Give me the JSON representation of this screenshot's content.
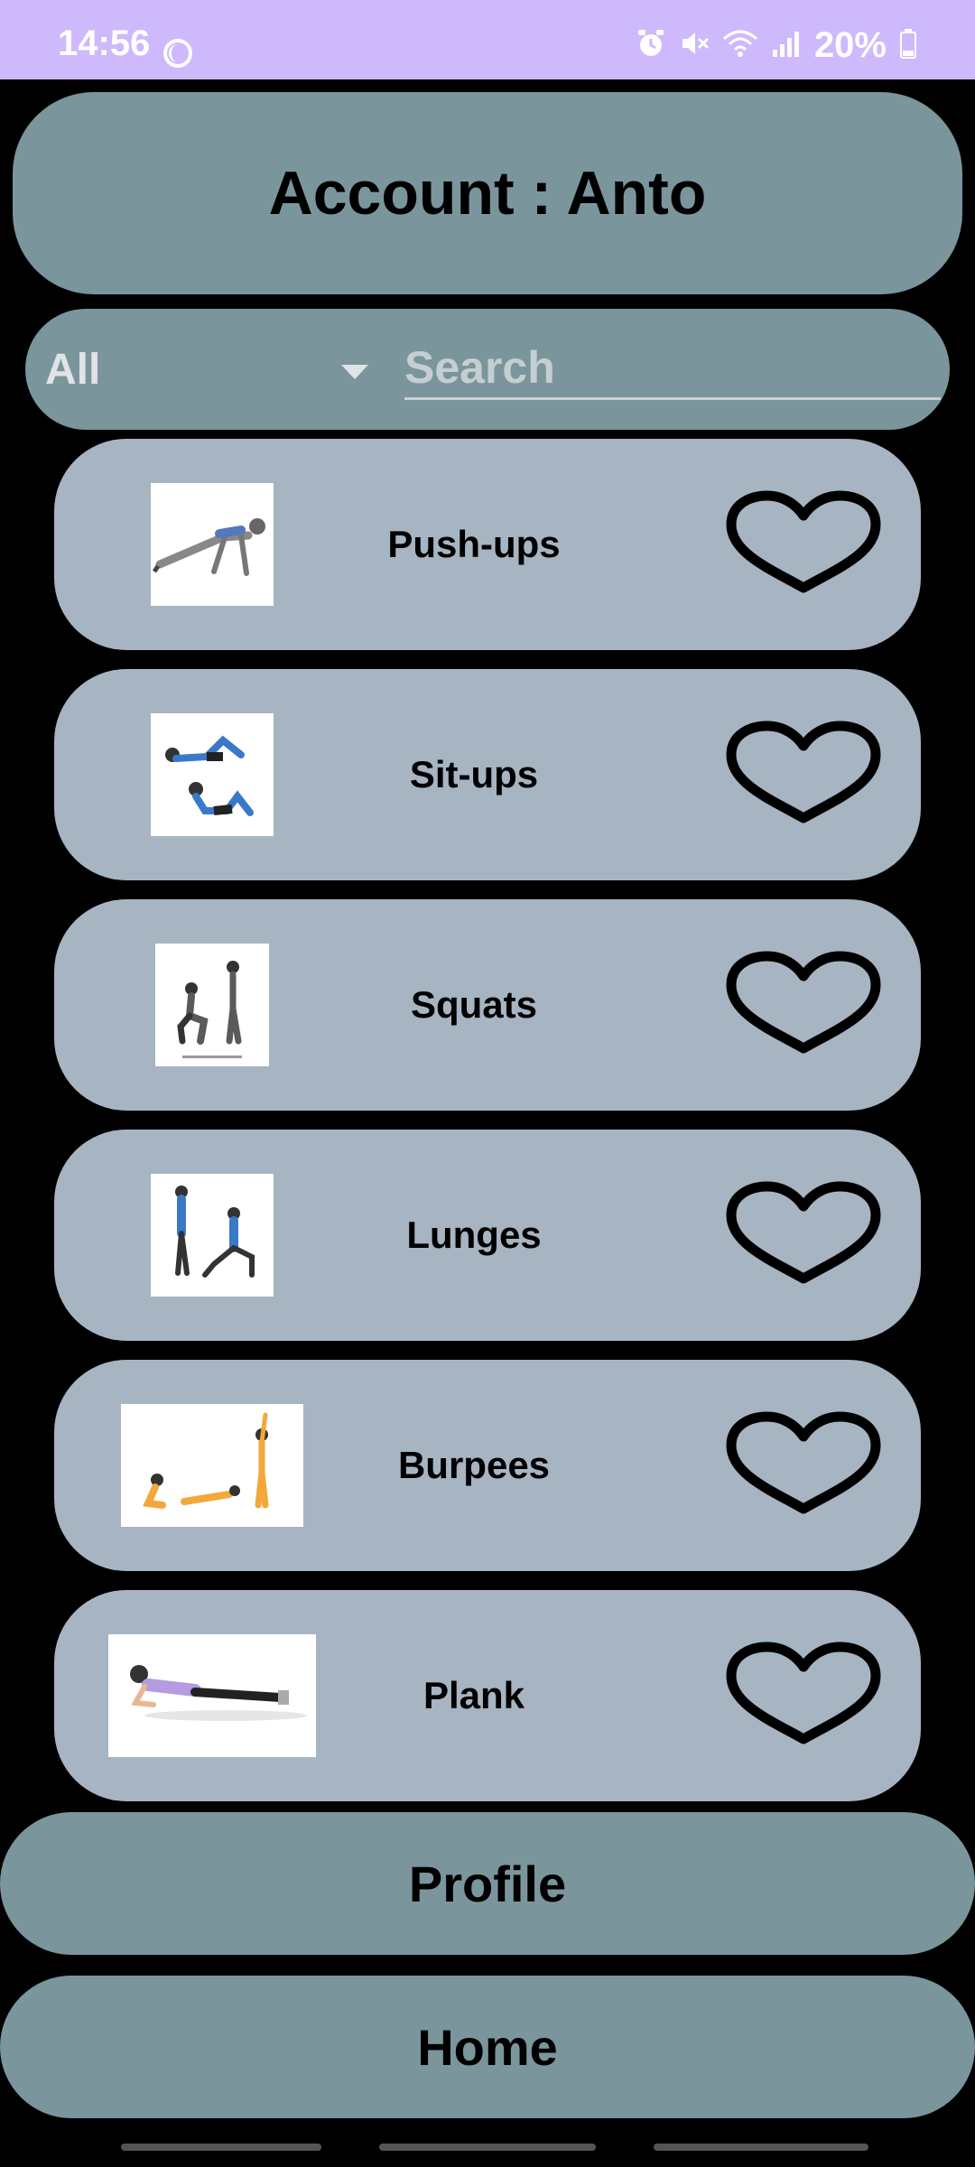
{
  "status_bar": {
    "time": "14:56",
    "battery": "20%",
    "icons": [
      "moon-icon",
      "alarm-icon",
      "mute-icon",
      "wifi-icon",
      "signal-icon",
      "battery-icon"
    ]
  },
  "header": {
    "title": "Account : Anto"
  },
  "filter": {
    "selected": "All",
    "search_placeholder": "Search"
  },
  "exercises": [
    {
      "name": "Push-ups",
      "favorite": false
    },
    {
      "name": "Sit-ups",
      "favorite": false
    },
    {
      "name": "Squats",
      "favorite": false
    },
    {
      "name": "Lunges",
      "favorite": false
    },
    {
      "name": "Burpees",
      "favorite": false
    },
    {
      "name": "Plank",
      "favorite": false
    }
  ],
  "nav": {
    "profile_label": "Profile",
    "home_label": "Home"
  },
  "colors": {
    "status_bar": "#cdb9fb",
    "header": "#7b959c",
    "card": "#a7b4c2",
    "background": "#000000"
  }
}
